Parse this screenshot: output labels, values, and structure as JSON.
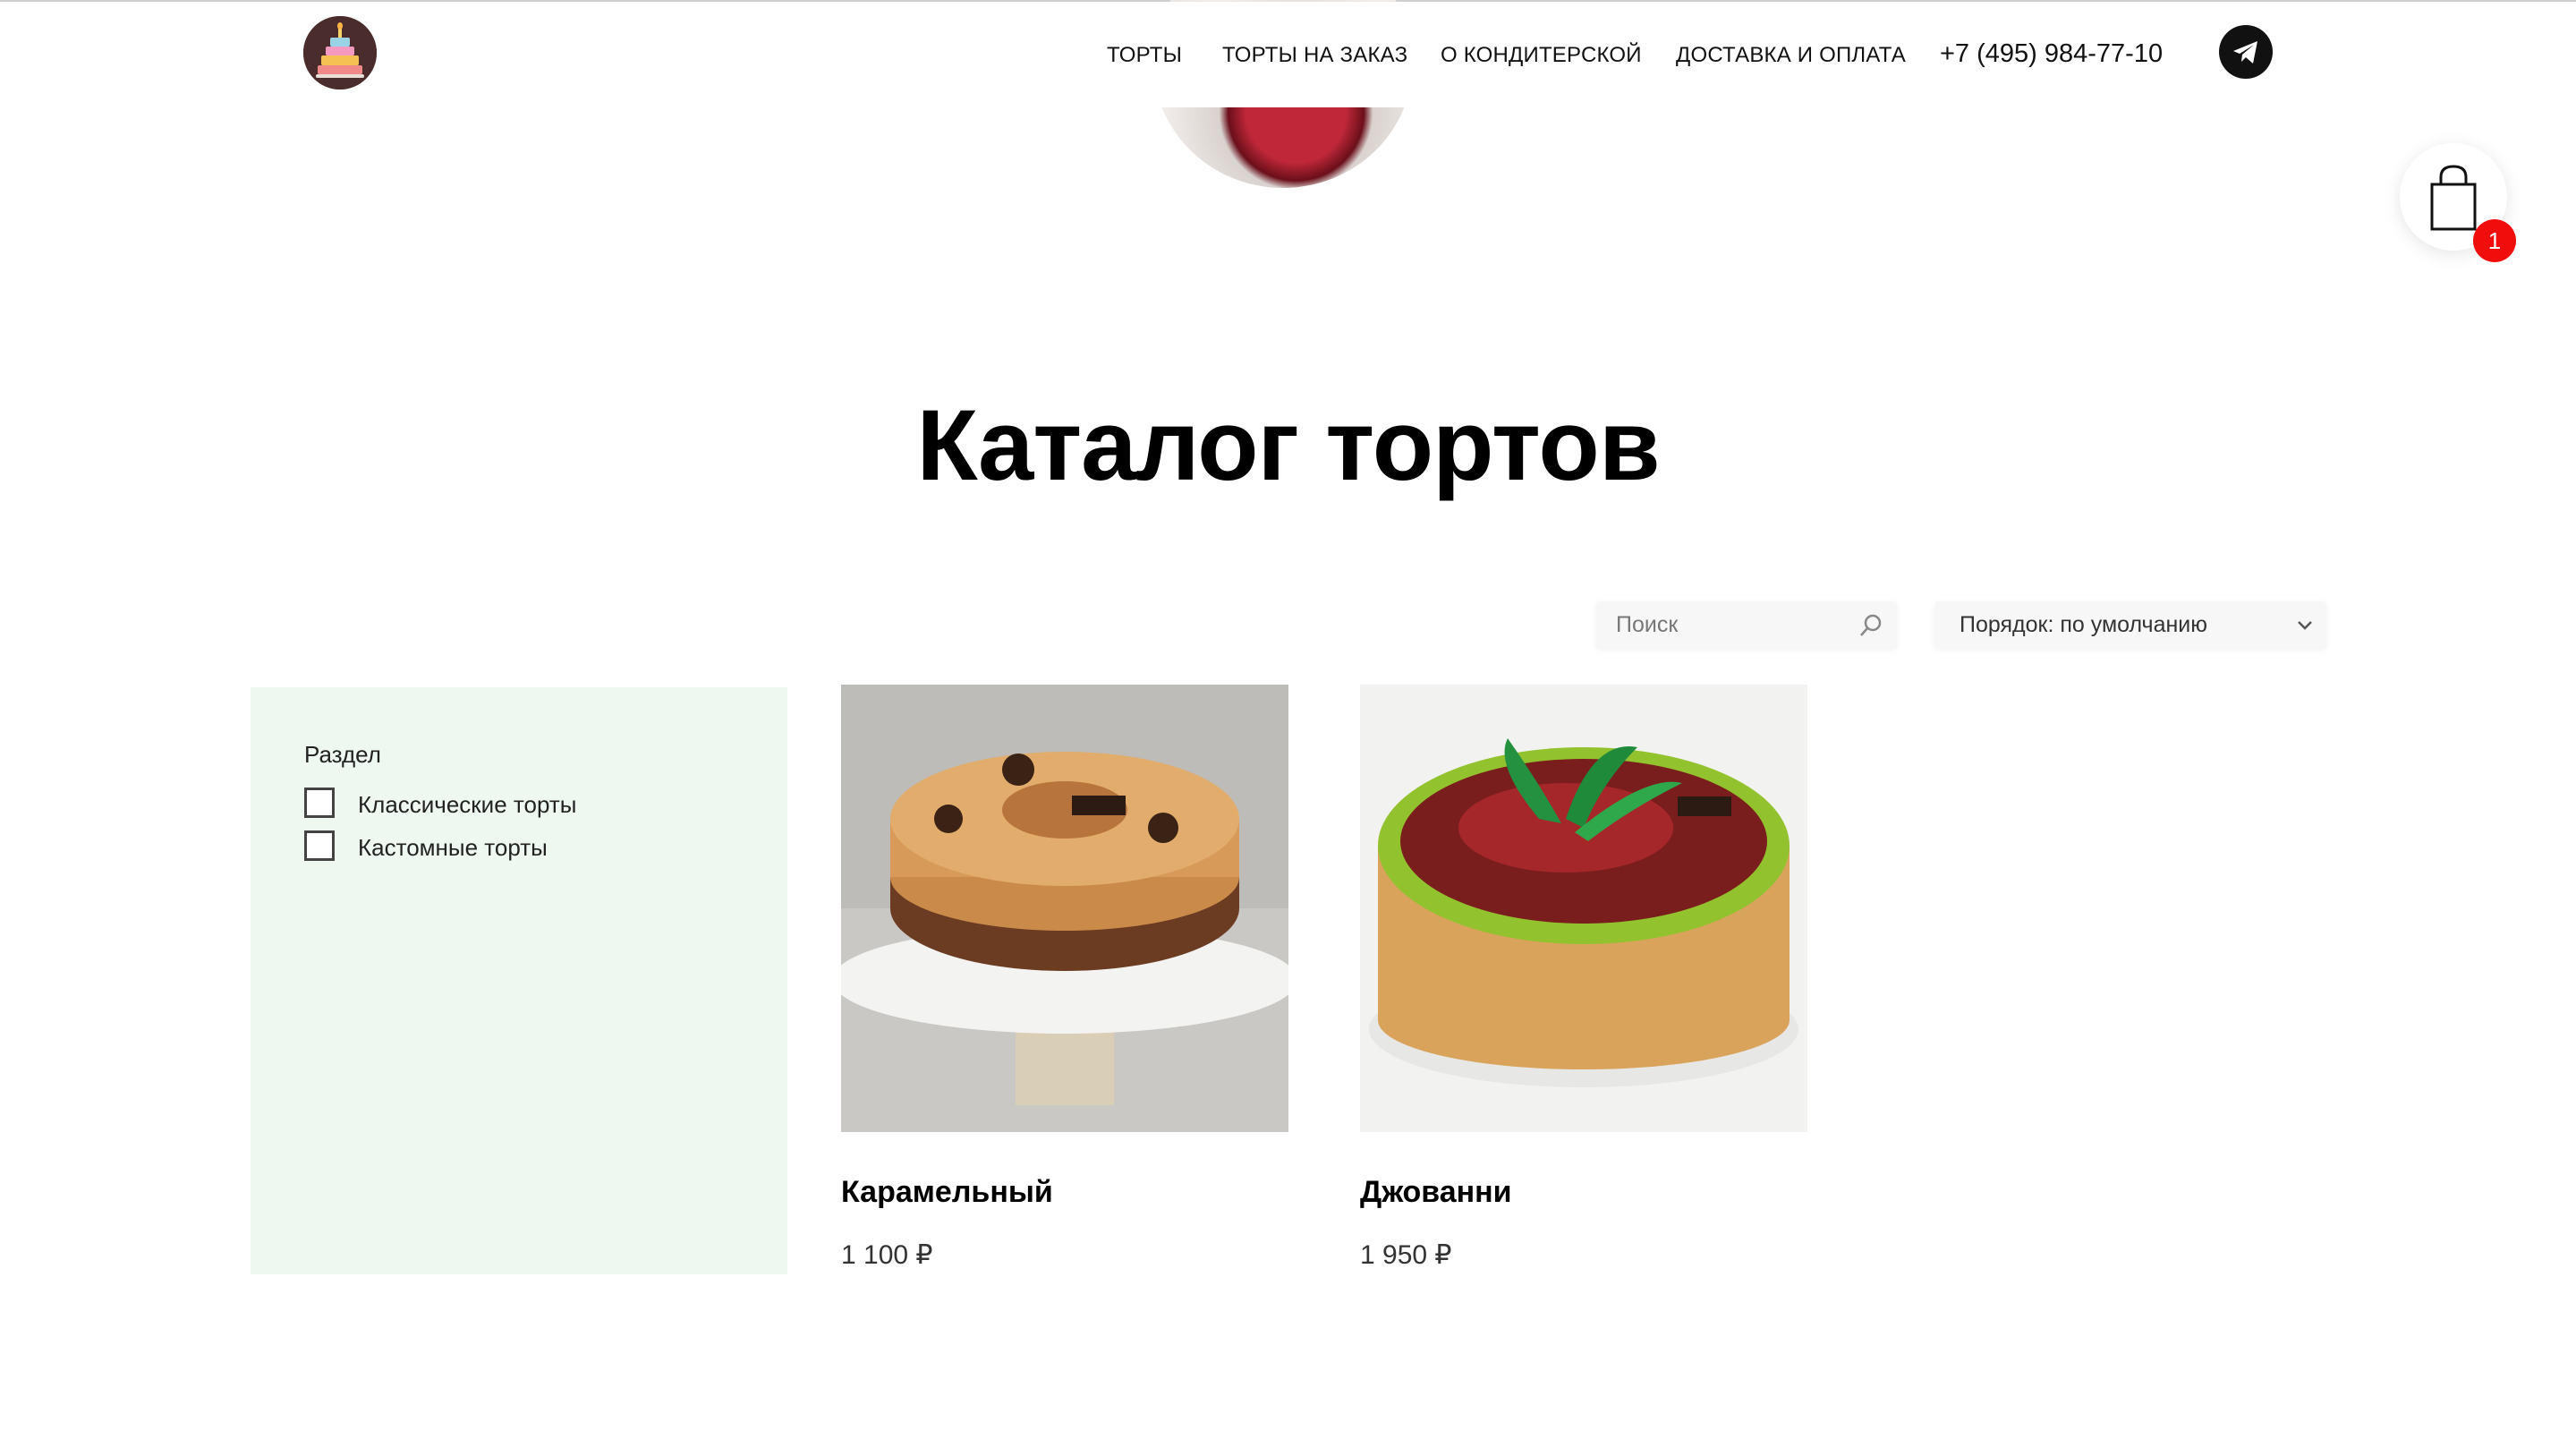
{
  "header": {
    "nav": [
      {
        "label": "ТОРТЫ"
      },
      {
        "label": "ТОРТЫ НА ЗАКАЗ"
      },
      {
        "label": "О КОНДИТЕРСКОЙ"
      },
      {
        "label": "ДОСТАВКА И ОПЛАТА"
      }
    ],
    "phone": "+7 (495) 984-77-10",
    "telegram_icon": "telegram-icon",
    "logo_icon": "cake-logo-icon"
  },
  "cart": {
    "count": "1",
    "icon": "shopping-bag-icon"
  },
  "page": {
    "title": "Каталог тортов"
  },
  "controls": {
    "search_placeholder": "Поиск",
    "sort_label": "Порядок: по умолчанию"
  },
  "filter": {
    "title": "Раздел",
    "options": [
      {
        "label": "Классические торты",
        "checked": false
      },
      {
        "label": "Кастомные торты",
        "checked": false
      }
    ]
  },
  "products": [
    {
      "name": "Карамельный",
      "price": "1 100 ₽"
    },
    {
      "name": "Джованни",
      "price": "1 950 ₽"
    }
  ],
  "colors": {
    "filter_bg": "#eef8f1",
    "badge": "#f20d0d",
    "text": "#111111"
  }
}
